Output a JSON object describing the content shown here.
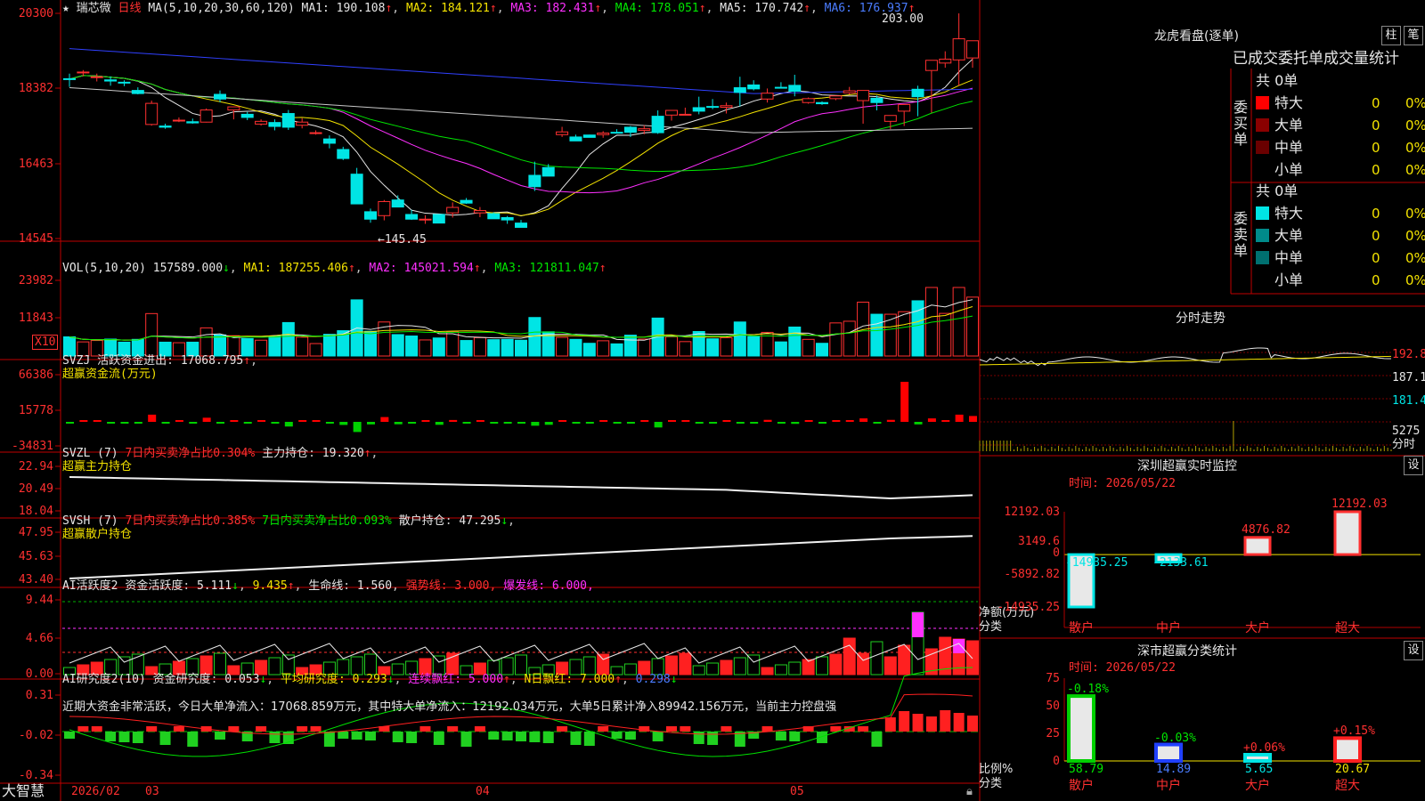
{
  "top": {
    "name": "★ 瑞芯微",
    "period": "日线",
    "ma_label": "MA(5,10,20,30,60,120)",
    "ma": [
      [
        "MA1",
        "190.108"
      ],
      [
        "MA2",
        "184.121"
      ],
      [
        "MA3",
        "182.431"
      ],
      [
        "MA4",
        "178.051"
      ],
      [
        "MA5",
        "170.742"
      ],
      [
        "MA6",
        "176.937"
      ]
    ],
    "ticks": [
      "20300",
      "18382",
      "16463",
      "14545"
    ],
    "high_label": "203.00",
    "low_label": "←145.45"
  },
  "vol": {
    "label": "VOL(5,10,20)",
    "value": "157589.000",
    "ma": [
      [
        "MA1",
        "187255.406"
      ],
      [
        "MA2",
        "145021.594"
      ],
      [
        "MA3",
        "121811.047"
      ]
    ],
    "ticks": [
      "23982",
      "11843"
    ],
    "unit": "X10"
  },
  "svzj": {
    "label": "SVZJ",
    "item": "活跃资金进出",
    "value": "17068.795",
    "sub": "超赢资金流(万元)",
    "ticks": [
      "66386",
      "15778",
      "-34831"
    ]
  },
  "svzl": {
    "label": "SVZL (7)",
    "t1": "7日内买卖净占比0.304%",
    "t2": "主力持仓",
    "value": "19.320",
    "sub": "超赢主力持仓",
    "ticks": [
      "22.94",
      "20.49",
      "18.04"
    ]
  },
  "svsh": {
    "label": "SVSH (7)",
    "t1": "7日内买卖净占比0.385%",
    "t2": "7日内买卖净占比0.093%",
    "t3": "散户持仓",
    "value": "47.295",
    "sub": "超赢散户持仓",
    "ticks": [
      "47.95",
      "45.63",
      "43.40"
    ]
  },
  "ai1": {
    "label": "AI活跃度2",
    "t1": "资金活跃度",
    "v1": "5.111",
    "v2": "9.435",
    "t3": "生命线",
    "v3": "1.560",
    "t4": "强势线",
    "v4": "3.000",
    "t5": "爆发线",
    "v5": "6.000",
    "ticks": [
      "9.44",
      "4.66",
      "0.00"
    ]
  },
  "ai2": {
    "label": "AI研究度2(10)",
    "t1": "资金研究度",
    "v1": "0.053",
    "t2": "平均研究度",
    "v2": "0.293",
    "t3": "连续飘红",
    "v3": "5.000",
    "t4": "N日飘红",
    "v4": "7.000",
    "v5": "0.298",
    "note": "近期大资金非常活跃，今日大单净流入：17068.859万元，其中特大单净流入：12192.034万元，大单5日累计净入89942.156万元，当前主力控盘强",
    "ticks": [
      "0.31",
      "-0.02",
      "-0.34"
    ]
  },
  "xaxis": {
    "brand": "大智慧",
    "labels": [
      "2026/02",
      "03",
      "04",
      "05"
    ]
  },
  "lh": {
    "title": "龙虎看盘(逐单)",
    "b1": "柱",
    "b2": "笔",
    "head": "已成交委托单成交量统计",
    "buy": "委买单",
    "sell": "委卖单",
    "buy_total": "共 0单",
    "sell_total": "共 0单",
    "rows": [
      "特大",
      "大单",
      "中单",
      "小单"
    ],
    "val": "0",
    "pct": "0%",
    "buy_colors": [
      "#ff0000",
      "#8a0000",
      "#6a0000",
      ""
    ],
    "sell_colors": [
      "#00e5e5",
      "#008a8a",
      "#007070",
      ""
    ]
  },
  "fs": {
    "title": "分时走势",
    "ticks": [
      "192.8",
      "187.1",
      "181.4"
    ],
    "vol_tick": "5275",
    "vol_unit": "分时"
  },
  "sz": {
    "title": "深圳超赢实时监控",
    "btn": "设",
    "time": "时间: 2026/05/22",
    "ticks": [
      "12192.03",
      "3149.6",
      "0",
      "-5892.82",
      "-14935.25"
    ],
    "ylabel": "净额(万元)",
    "xlabel": "分类",
    "cats": [
      "散户",
      "中户",
      "大户",
      "超大"
    ]
  },
  "cl": {
    "title": "深市超赢分类统计",
    "btn": "设",
    "time": "时间: 2026/05/22",
    "ticks": [
      "75",
      "50",
      "25",
      "0"
    ],
    "ylabel": "比例%",
    "xlabel": "分类",
    "cats": [
      "散户",
      "中户",
      "大户",
      "超大"
    ]
  },
  "chart_data": {
    "type": "bar",
    "categories": [
      "散户",
      "中户",
      "大户",
      "超大"
    ],
    "series": [
      {
        "name": "净额(万元)",
        "values": [
          -14935.25,
          -2133.61,
          4876.82,
          12192.03
        ],
        "value_labels": [
          "-14935.25",
          "-2133.61",
          "4876.82",
          "12192.03"
        ]
      },
      {
        "name": "比例%",
        "values": [
          58.79,
          14.89,
          5.65,
          20.67
        ],
        "change_labels": [
          "-0.18%",
          "-0.03%",
          "+0.06%",
          "+0.15%"
        ]
      }
    ],
    "ylim": [
      -14935.25,
      12192.03
    ],
    "candles": [
      [
        186.3,
        187.6,
        184.2,
        186.2
      ],
      [
        187.9,
        188.5,
        186.9,
        188
      ],
      [
        186.6,
        187.6,
        185.6,
        186.8
      ],
      [
        186,
        186.9,
        184.5,
        185.7
      ],
      [
        185.4,
        185.9,
        184.4,
        185.3
      ],
      [
        183.3,
        184.1,
        182.3,
        182.5
      ],
      [
        174.6,
        180.7,
        174.3,
        180
      ],
      [
        174.2,
        174.8,
        173.5,
        173.9
      ],
      [
        175.5,
        176.4,
        175.2,
        175.7
      ],
      [
        175.3,
        176.1,
        174.8,
        175
      ],
      [
        175.2,
        178.7,
        175.1,
        178.3
      ],
      [
        182.3,
        183.3,
        180.3,
        181.1
      ],
      [
        178.3,
        179,
        175.9,
        179.1
      ],
      [
        177.2,
        177.8,
        175.7,
        176.4
      ],
      [
        174.7,
        175.9,
        174.3,
        175.4
      ],
      [
        175.1,
        175.9,
        173.1,
        174.1
      ],
      [
        177.4,
        178.3,
        173.2,
        173.9
      ],
      [
        174.4,
        176.2,
        173.6,
        175.2
      ],
      [
        172.5,
        173.1,
        172,
        172.5
      ],
      [
        170.9,
        171.8,
        168.5,
        169.8
      ],
      [
        168.2,
        168.9,
        165.5,
        165.9
      ],
      [
        161.9,
        163.5,
        154.4,
        154.3
      ],
      [
        152.3,
        153.1,
        149.5,
        150.4
      ],
      [
        151.3,
        155.3,
        150.1,
        154.9
      ],
      [
        155.3,
        156.5,
        154,
        153.5
      ],
      [
        151.6,
        152.8,
        150.2,
        150.4
      ],
      [
        150.2,
        151.4,
        149.2,
        150.4
      ],
      [
        151.6,
        151.5,
        150.6,
        149.4
      ],
      [
        152,
        154.7,
        150.8,
        153.4
      ],
      [
        155.2,
        155.8,
        154.3,
        154.5
      ],
      [
        152,
        153.5,
        150.9,
        152.6
      ],
      [
        151.8,
        152.1,
        150.9,
        150.5
      ],
      [
        150.8,
        151.2,
        149.2,
        150.2
      ],
      [
        149.4,
        150.2,
        149,
        148.3
      ],
      [
        161.6,
        165.1,
        157.6,
        158.7
      ],
      [
        163.6,
        164.5,
        161.4,
        161.4
      ],
      [
        172,
        174,
        171.4,
        172.7
      ],
      [
        171.4,
        172,
        170.4,
        170.4
      ],
      [
        171.9,
        172,
        171.4,
        171.3
      ],
      [
        172,
        172.9,
        171.2,
        172.4
      ],
      [
        172.6,
        173.4,
        172.5,
        172.5
      ],
      [
        173.9,
        174.2,
        171.4,
        172.6
      ],
      [
        173.1,
        174.4,
        172.1,
        173.5
      ],
      [
        176.7,
        178.2,
        172.2,
        172.5
      ],
      [
        177,
        177.9,
        175.6,
        178.2
      ],
      [
        177.2,
        178.9,
        177.1,
        177.2
      ],
      [
        178.9,
        181.7,
        177.2,
        178
      ],
      [
        179.2,
        181.1,
        178.5,
        179
      ],
      [
        179,
        180.2,
        177.4,
        179.4
      ],
      [
        184,
        186.8,
        179.2,
        182.8
      ],
      [
        184.7,
        185.9,
        183.3,
        183.7
      ],
      [
        181.1,
        183.8,
        180.2,
        182.6
      ],
      [
        184.1,
        185.4,
        183.8,
        184
      ],
      [
        184.6,
        187.3,
        181.8,
        183.1
      ],
      [
        180.2,
        181.5,
        179.9,
        181.2
      ],
      [
        180.2,
        180.5,
        179.6,
        179.9
      ],
      [
        181.2,
        181.9,
        180.8,
        181.9
      ],
      [
        182.7,
        184.2,
        182.3,
        183.2
      ],
      [
        180.7,
        181.4,
        174.8,
        183.3
      ],
      [
        181.3,
        182,
        178.2,
        180.2
      ],
      [
        175.4,
        176.8,
        173.4,
        176.9
      ],
      [
        178,
        178.3,
        174.2,
        179.7
      ],
      [
        183.6,
        184.5,
        176.7,
        181.7
      ],
      [
        188.4,
        189.5,
        177.6,
        191
      ],
      [
        190.3,
        193.3,
        189.1,
        191.3
      ],
      [
        191.1,
        203,
        184.5,
        196.5
      ],
      [
        191.6,
        195.7,
        189.1,
        196
      ]
    ]
  }
}
